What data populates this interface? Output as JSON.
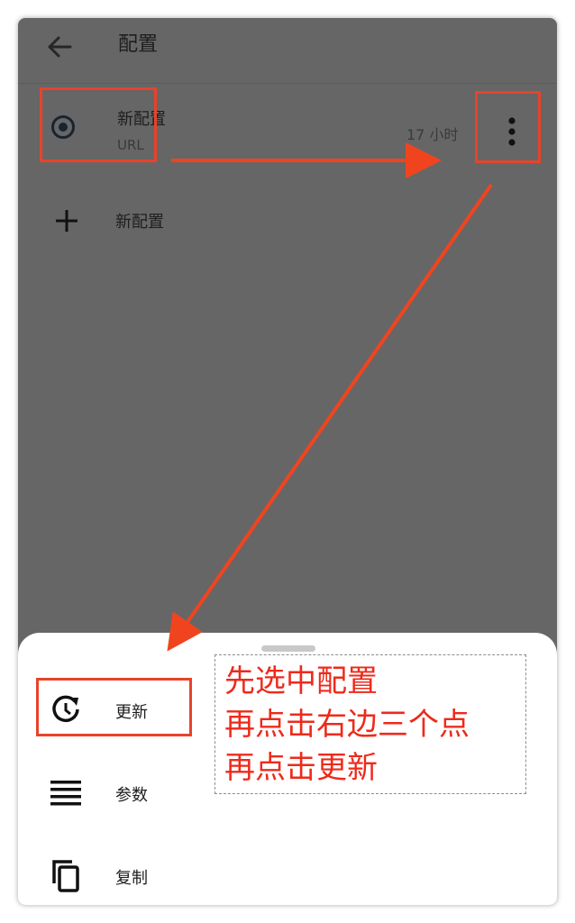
{
  "appbar": {
    "title": "配置",
    "back_icon": "arrow-left-icon"
  },
  "profile": {
    "name": "新配置",
    "type": "URL",
    "updated": "17 小时",
    "selected": true,
    "more_icon": "more-vert-icon"
  },
  "new_profile": {
    "label": "新配置",
    "icon": "plus-icon"
  },
  "sheet": {
    "items": [
      {
        "label": "更新",
        "icon": "update-clock-icon"
      },
      {
        "label": "参数",
        "icon": "menu-lines-icon"
      },
      {
        "label": "复制",
        "icon": "copy-icon"
      }
    ]
  },
  "annotation": {
    "lines": [
      "先选中配置",
      "再点击右边三个点",
      "再点击更新"
    ],
    "color": "#ee2a1b"
  },
  "colors": {
    "dim_background": "#666666",
    "highlight": "#e8432a",
    "sheet": "#ffffff"
  }
}
